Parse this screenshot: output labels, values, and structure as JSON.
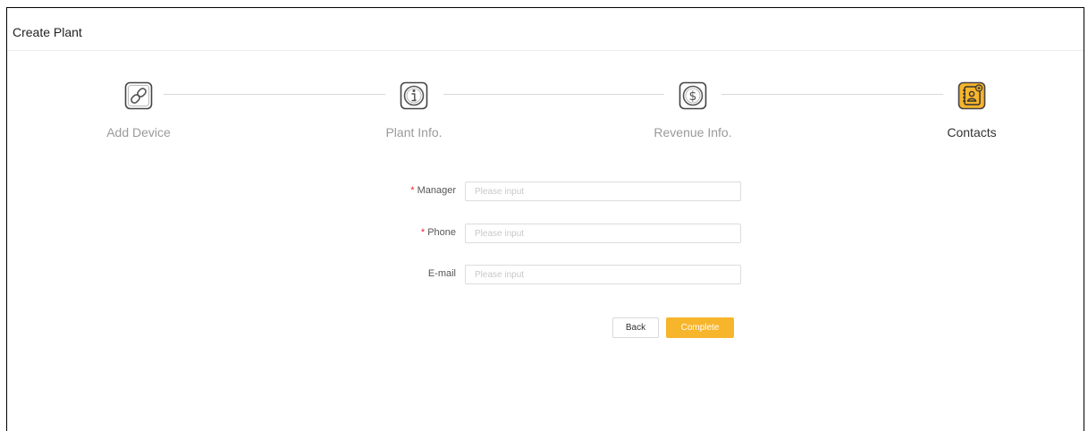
{
  "header": {
    "title": "Create Plant"
  },
  "steps": [
    {
      "label": "Add Device",
      "icon": "link-icon",
      "active": false
    },
    {
      "label": "Plant Info.",
      "icon": "info-icon",
      "active": false
    },
    {
      "label": "Revenue Info.",
      "icon": "dollar-icon",
      "active": false
    },
    {
      "label": "Contacts",
      "icon": "contact-book-icon",
      "active": true
    }
  ],
  "colors": {
    "accent": "#f7b52b",
    "required": "#f5222d",
    "inactive_icon": "#888888"
  },
  "form": {
    "manager": {
      "required_mark": "*",
      "label": "Manager",
      "value": "",
      "placeholder": "Please input"
    },
    "phone": {
      "required_mark": "*",
      "label": "Phone",
      "value": "",
      "placeholder": "Please input"
    },
    "email": {
      "label": "E-mail",
      "value": "",
      "placeholder": "Please input"
    }
  },
  "buttons": {
    "back": "Back",
    "complete": "Complete"
  }
}
